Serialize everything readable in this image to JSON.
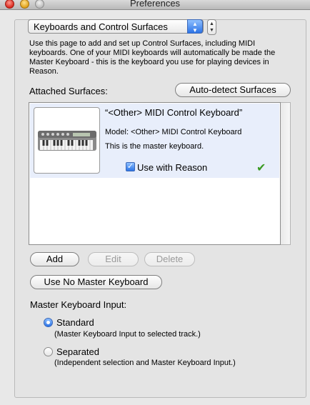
{
  "window": {
    "title": "Preferences"
  },
  "page_selector": {
    "selected": "Keyboards and Control Surfaces"
  },
  "description": "Use this page to add and set up Control Surfaces, including MIDI keyboards. One of your MIDI keyboards will automatically be made the Master Keyboard - this is the keyboard you use for playing devices in Reason.",
  "attached": {
    "label": "Attached Surfaces:",
    "autodetect_button": "Auto-detect Surfaces",
    "surfaces": [
      {
        "title": "“<Other> MIDI Control Keyboard”",
        "model": "Model: <Other> MIDI Control Keyboard",
        "status": "This is the master keyboard.",
        "use_with_reason_label": "Use with Reason",
        "use_with_reason": true,
        "icon": "midi-keyboard-image"
      }
    ]
  },
  "actions": {
    "add": "Add",
    "edit": "Edit",
    "delete": "Delete",
    "use_no_master": "Use No Master Keyboard"
  },
  "master_input": {
    "label": "Master Keyboard Input:",
    "options": [
      {
        "label": "Standard",
        "note": "(Master Keyboard Input to selected track.)",
        "selected": true
      },
      {
        "label": "Separated",
        "note": "(Independent selection and Master Keyboard Input.)",
        "selected": false
      }
    ]
  },
  "colors": {
    "selection_row": "#e8eefb",
    "accent_blue": "#2c73e6",
    "check_green": "#3a9a22"
  }
}
